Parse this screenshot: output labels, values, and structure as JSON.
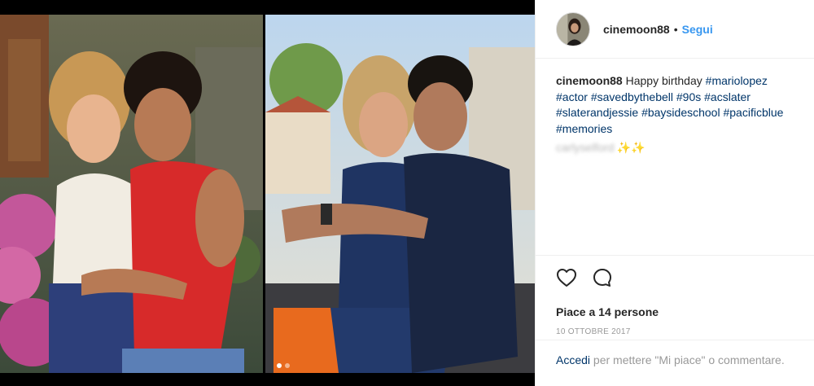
{
  "post": {
    "username": "cinemoon88",
    "separator": "•",
    "follow_label": "Segui",
    "caption": {
      "username": "cinemoon88",
      "text": "Happy birthday",
      "hashtags": [
        "#mariolopez",
        "#actor",
        "#savedbythebell",
        "#90s",
        "#acslater",
        "#slaterandjessie",
        "#baysideschool",
        "#pacificblue",
        "#memories"
      ],
      "blurred_handle": "carlyselford",
      "emoji": "✨✨"
    },
    "likes_text": "Piace a 14 persone",
    "date": "10 OTTOBRE 2017",
    "login": {
      "link": "Accedi",
      "rest": "per mettere \"Mi piace\" o commentare."
    }
  },
  "media": {
    "carousel_count": 2,
    "active_index": 0
  },
  "icons": {
    "like": "heart-icon",
    "comment": "comment-icon"
  },
  "colors": {
    "link": "#3897f0",
    "hashtag": "#003569",
    "text": "#262626",
    "muted": "#999999"
  }
}
